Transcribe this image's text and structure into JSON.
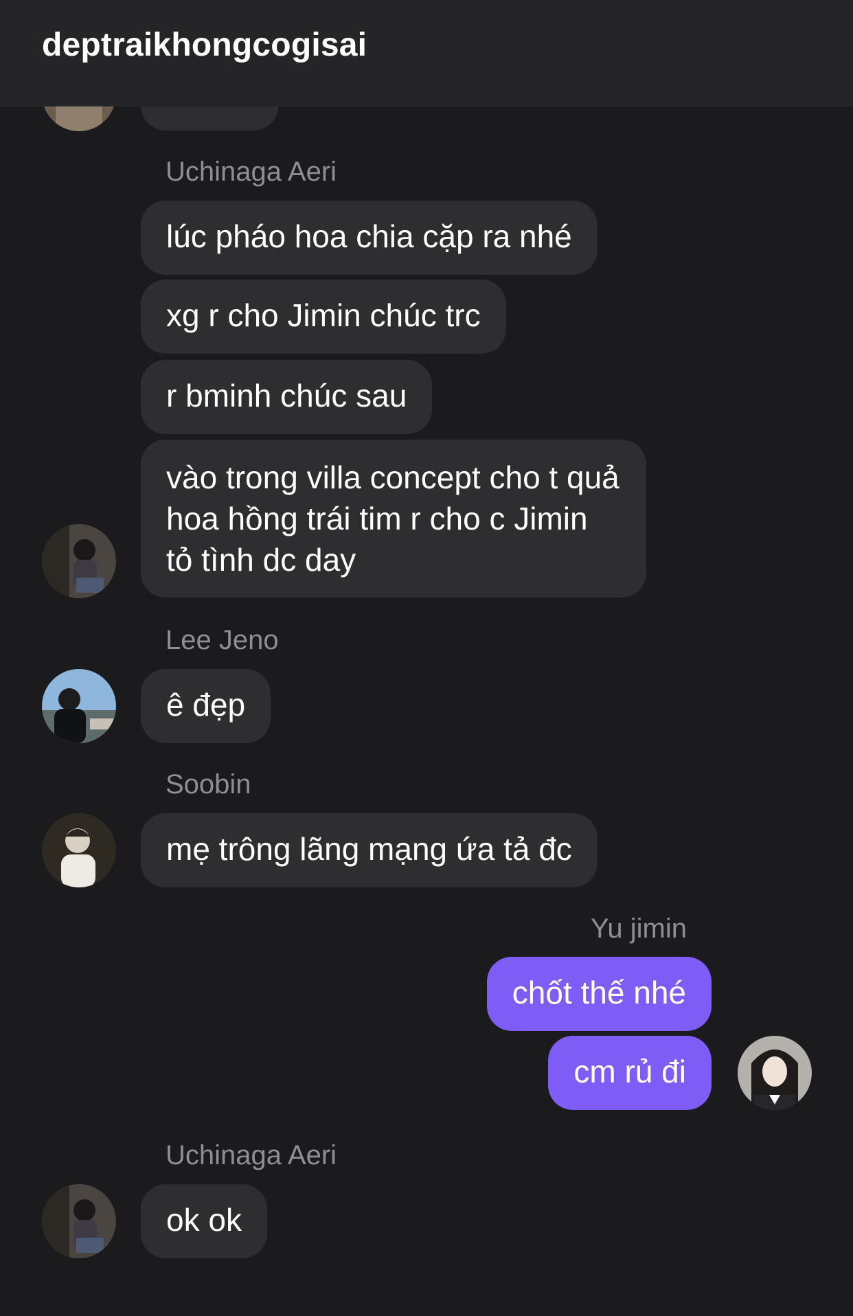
{
  "header": {
    "title": "deptraikhongcogisai"
  },
  "messages": {
    "partial": {
      "text": ""
    },
    "aeri1": {
      "sender": "Uchinaga Aeri",
      "m1": " lúc pháo hoa chia cặp ra nhé",
      "m2": "xg r cho Jimin chúc trc",
      "m3": "r bminh chúc sau",
      "m4": "vào trong villa concept cho t quả hoa hồng trái tim r cho c Jimin tỏ tình dc day"
    },
    "jeno": {
      "sender": "Lee Jeno",
      "m1": "ê đẹp"
    },
    "soobin": {
      "sender": "Soobin",
      "m1": "mẹ trông lãng mạng ứa tả đc"
    },
    "jimin": {
      "sender": "Yu jimin",
      "m1": "chốt thế nhé",
      "m2": "cm rủ đi"
    },
    "aeri2": {
      "sender": "Uchinaga Aeri",
      "m1": "ok ok"
    }
  },
  "colors": {
    "background": "#1b1b1d",
    "header": "#252527",
    "incoming_bubble": "#2e2e30",
    "outgoing_bubble": "#7e5cf6",
    "sender_name": "#8e8e93"
  },
  "icons": [
    "avatar-aeri",
    "avatar-jeno",
    "avatar-soobin",
    "avatar-jimin"
  ]
}
